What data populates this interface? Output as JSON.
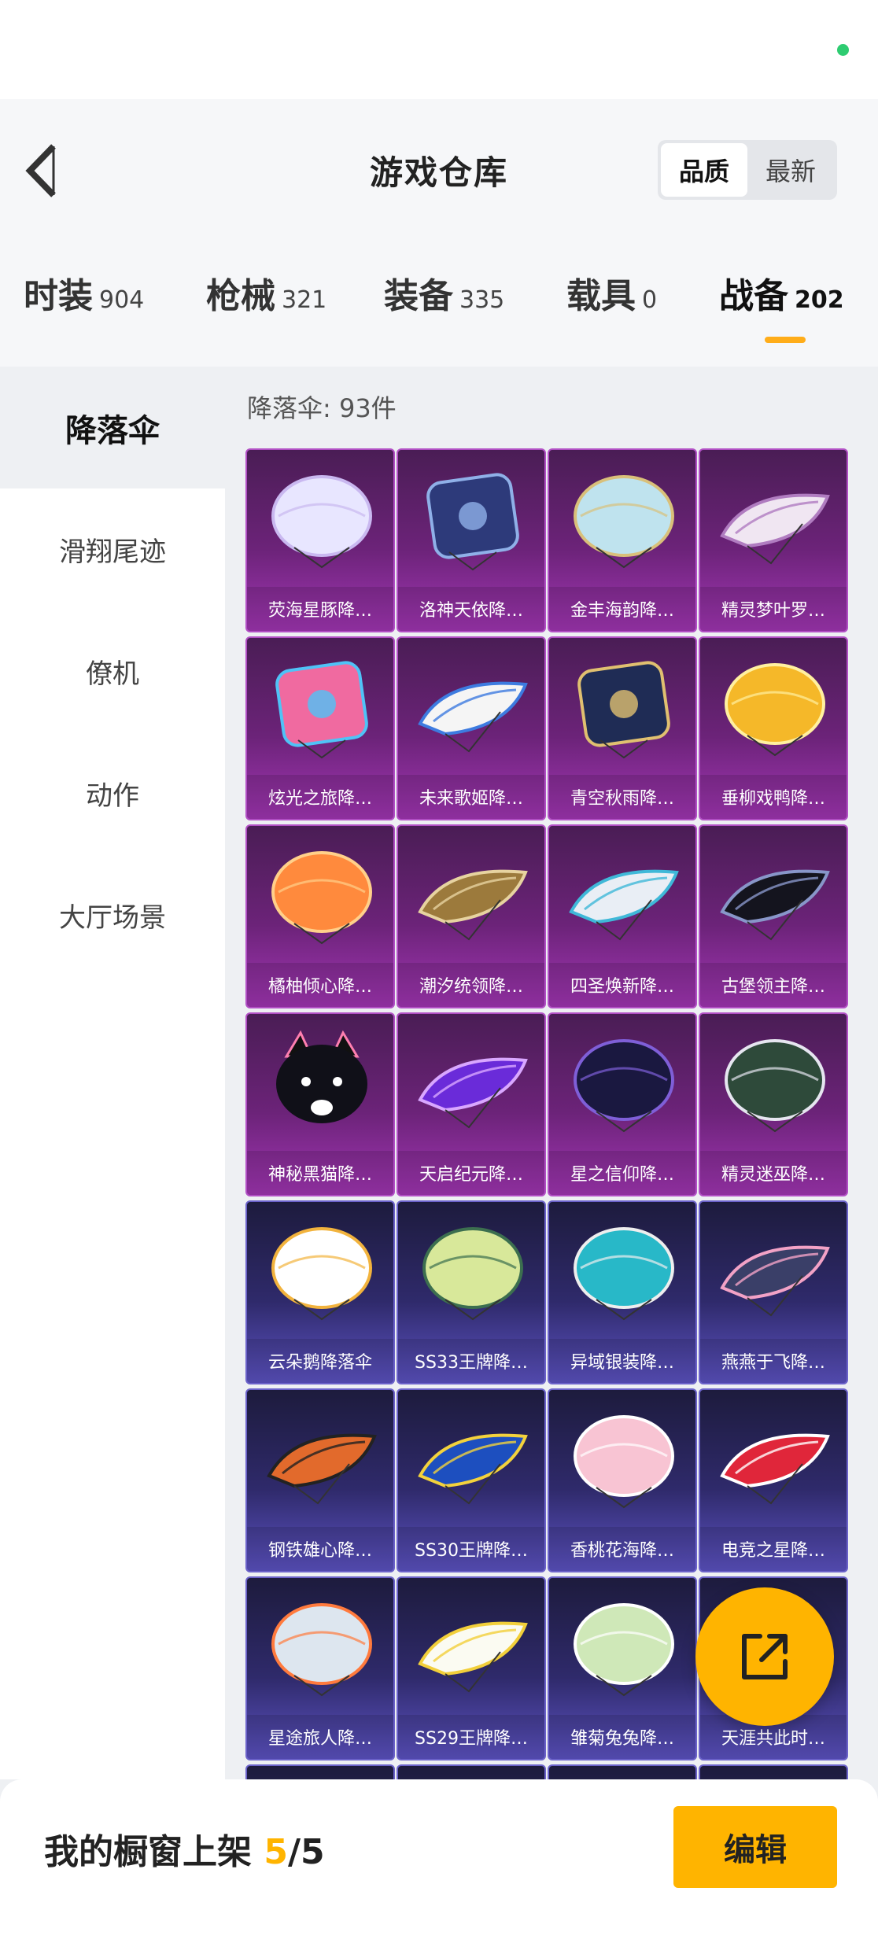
{
  "header": {
    "title": "游戏仓库",
    "sort_options": [
      "品质",
      "最新"
    ]
  },
  "tabs": [
    {
      "label": "时装",
      "count": "904"
    },
    {
      "label": "枪械",
      "count": "321"
    },
    {
      "label": "装备",
      "count": "335"
    },
    {
      "label": "载具",
      "count": "0"
    },
    {
      "label": "战备",
      "count": "202"
    }
  ],
  "sidebar": {
    "items": [
      "降落伞",
      "滑翔尾迹",
      "僚机",
      "动作",
      "大厅场景"
    ]
  },
  "content": {
    "count_label": "降落伞: 93件"
  },
  "items": [
    "荧海星豚降…",
    "洛神天依降…",
    "金丰海韵降…",
    "精灵梦叶罗…",
    "炫光之旅降…",
    "未来歌姬降…",
    "青空秋雨降…",
    "垂柳戏鸭降…",
    "橘柚倾心降…",
    "潮汐统领降…",
    "四圣焕新降…",
    "古堡领主降…",
    "神秘黑猫降…",
    "天启纪元降…",
    "星之信仰降…",
    "精灵迷巫降…",
    "云朵鹅降落伞",
    "SS33王牌降…",
    "异域银装降…",
    "燕燕于飞降…",
    "钢铁雄心降…",
    "SS30王牌降…",
    "香桃花海降…",
    "电竞之星降…",
    "星途旅人降…",
    "SS29王牌降…",
    "雏菊兔兔降…",
    "天涯共此时…"
  ],
  "bottom": {
    "showcase_label": "我的橱窗上架",
    "showcase_count": "5",
    "showcase_total": "/5",
    "edit_label": "编辑"
  },
  "colors": {
    "accent": "#ffb400",
    "status_dot": "#2ecc71"
  }
}
